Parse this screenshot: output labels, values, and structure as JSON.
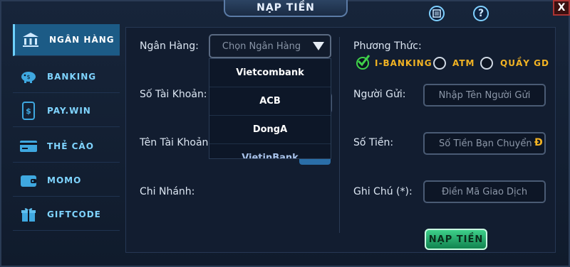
{
  "window": {
    "title": "NẠP TIỀN",
    "close_label": "X"
  },
  "sidebar": {
    "items": [
      {
        "label": "NGÂN HÀNG",
        "icon": "bank-icon",
        "active": true
      },
      {
        "label": "BANKING",
        "icon": "piggy-bank-icon",
        "active": false
      },
      {
        "label": "PAY.WIN",
        "icon": "phone-dollar-icon",
        "active": false
      },
      {
        "label": "THẺ CÀO",
        "icon": "card-icon",
        "active": false
      },
      {
        "label": "MOMO",
        "icon": "wallet-icon",
        "active": false
      },
      {
        "label": "GIFTCODE",
        "icon": "gift-icon",
        "active": false
      }
    ]
  },
  "form": {
    "bank_label": "Ngân Hàng:",
    "bank_select_value": "Chọn Ngân Hàng",
    "account_number_label": "Số Tài Khoản:",
    "account_name_label": "Tên Tài Khoản:",
    "branch_label": "Chi Nhánh:",
    "bank_options": [
      "Vietcombank",
      "ACB",
      "DongA",
      "VietinBank"
    ]
  },
  "payment": {
    "method_label": "Phương Thức:",
    "methods": [
      {
        "label": "I-BANKING",
        "selected": true
      },
      {
        "label": "ATM",
        "selected": false
      },
      {
        "label": "QUẦY GD",
        "selected": false
      }
    ],
    "sender_label": "Người Gửi:",
    "sender_placeholder": "Nhập Tên Người Gửi",
    "amount_label": "Số Tiền:",
    "amount_placeholder": "Số Tiền Bạn Chuyển",
    "currency_symbol": "Đ",
    "note_label": "Ghi Chú (*):",
    "note_placeholder": "Điền Mã Giao Dịch",
    "submit_label": "NẠP TIỀN"
  },
  "colors": {
    "accent": "#6fd1ff",
    "gold": "#f2b323",
    "submit": "#2fb873",
    "check": "#3fd04a"
  }
}
